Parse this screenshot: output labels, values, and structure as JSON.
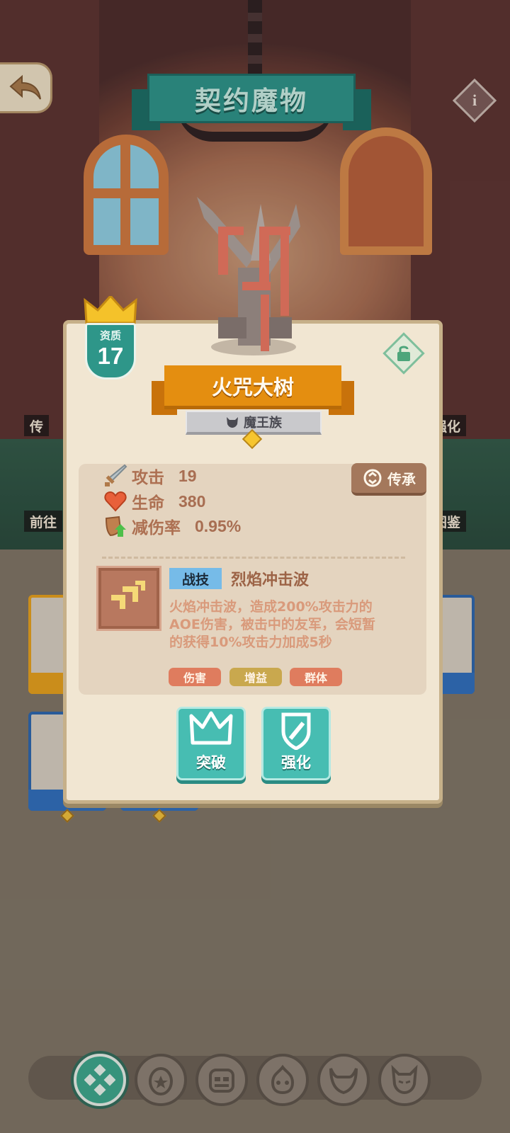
{
  "header": {
    "title": "契约魔物",
    "back_icon": "back-arrow-icon",
    "info_icon": "info-icon",
    "info_glyph": "i"
  },
  "background": {
    "side_labels": [
      "传",
      "前往",
      "强化",
      "图鉴"
    ]
  },
  "monster": {
    "quality_label": "资质",
    "quality_value": "17",
    "name": "火咒大树",
    "tribe": "魔王族",
    "stats": [
      {
        "icon": "sword-icon",
        "label": "攻击",
        "value": "19"
      },
      {
        "icon": "heart-icon",
        "label": "生命",
        "value": "380"
      },
      {
        "icon": "shield-icon",
        "label": "减伤率",
        "value": "0.95%"
      }
    ],
    "inherit_label": "传承",
    "skill": {
      "tag": "战技",
      "name": "烈焰冲击波",
      "description_lines": [
        "火焰冲击波，造成200%攻击力的",
        "AOE伤害，被击中的友军，会短暂",
        "的获得10%攻击力加成5秒"
      ],
      "chips": [
        {
          "label": "伤害",
          "color": "#df7c5e"
        },
        {
          "label": "增益",
          "color": "#c9a84e"
        },
        {
          "label": "群体",
          "color": "#df7c5e"
        }
      ]
    },
    "actions": {
      "breakthrough": "突破",
      "enhance": "强化"
    }
  },
  "bottom_nav": {
    "items": [
      "grid-icon",
      "egg-star-icon",
      "beast-face-icon",
      "flame-skull-icon",
      "horned-mask-icon",
      "demon-face-icon"
    ],
    "active_index": 0
  },
  "colors": {
    "teal": "#2a958a",
    "orange": "#e48e10",
    "panel": "#f1e6d2"
  }
}
